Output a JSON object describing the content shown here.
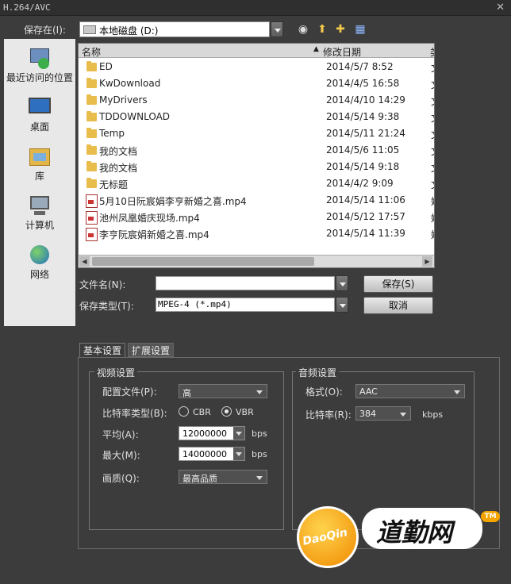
{
  "window": {
    "title": "H.264/AVC",
    "close": "✕"
  },
  "save_in": {
    "label": "保存在(I):",
    "value": "本地磁盘 (D:)"
  },
  "places": [
    {
      "label": "最近访问的位置",
      "icon": "recent-places-icon"
    },
    {
      "label": "桌面",
      "icon": "desktop-icon"
    },
    {
      "label": "库",
      "icon": "libraries-icon"
    },
    {
      "label": "计算机",
      "icon": "computer-icon"
    },
    {
      "label": "网络",
      "icon": "network-icon"
    }
  ],
  "columns": {
    "name": "名称",
    "date": "修改日期",
    "extra": "类"
  },
  "files": [
    {
      "name": "ED",
      "date": "2014/5/7 8:52",
      "extra": "文",
      "type": "folder"
    },
    {
      "name": "KwDownload",
      "date": "2014/4/5 16:58",
      "extra": "文",
      "type": "folder"
    },
    {
      "name": "MyDrivers",
      "date": "2014/4/10 14:29",
      "extra": "文",
      "type": "folder"
    },
    {
      "name": "TDDOWNLOAD",
      "date": "2014/5/14 9:38",
      "extra": "文",
      "type": "folder"
    },
    {
      "name": "Temp",
      "date": "2014/5/11 21:24",
      "extra": "文",
      "type": "folder"
    },
    {
      "name": "我的文档",
      "date": "2014/5/6 11:05",
      "extra": "文",
      "type": "folder"
    },
    {
      "name": "我的文档",
      "date": "2014/5/14 9:18",
      "extra": "文",
      "type": "folder"
    },
    {
      "name": "无标题",
      "date": "2014/4/2 9:09",
      "extra": "文",
      "type": "folder"
    },
    {
      "name": "5月10日阮宸娟李亨新婚之喜.mp4",
      "date": "2014/5/14 11:06",
      "extra": "媒",
      "type": "video"
    },
    {
      "name": "池州凤凰婚庆现场.mp4",
      "date": "2014/5/12 17:57",
      "extra": "媒",
      "type": "video"
    },
    {
      "name": "李亨阮宸娟新婚之喜.mp4",
      "date": "2014/5/14 11:39",
      "extra": "媒",
      "type": "video"
    }
  ],
  "filename": {
    "label": "文件名(N):",
    "value": ""
  },
  "filetype": {
    "label": "保存类型(T):",
    "value": "MPEG-4 (*.mp4)"
  },
  "buttons": {
    "save": "保存(S)",
    "cancel": "取消"
  },
  "tabs": [
    {
      "label": "基本设置",
      "active": true
    },
    {
      "label": "扩展设置",
      "active": false
    }
  ],
  "video": {
    "title": "视频设置",
    "profile_label": "配置文件(P):",
    "profile_value": "高",
    "bitrate_type_label": "比特率类型(B):",
    "cbr": "CBR",
    "vbr": "VBR",
    "selected": "VBR",
    "avg_label": "平均(A):",
    "avg_value": "12000000",
    "avg_unit": "bps",
    "max_label": "最大(M):",
    "max_value": "14000000",
    "max_unit": "bps",
    "quality_label": "画质(Q):",
    "quality_value": "最高品质"
  },
  "audio": {
    "title": "音频设置",
    "format_label": "格式(O):",
    "format_value": "AAC",
    "bitrate_label": "比特率(R):",
    "bitrate_value": "384",
    "bitrate_unit": "kbps"
  },
  "watermark": {
    "badge": "DaoQin",
    "tm": "TM",
    "text": "道勤网"
  }
}
